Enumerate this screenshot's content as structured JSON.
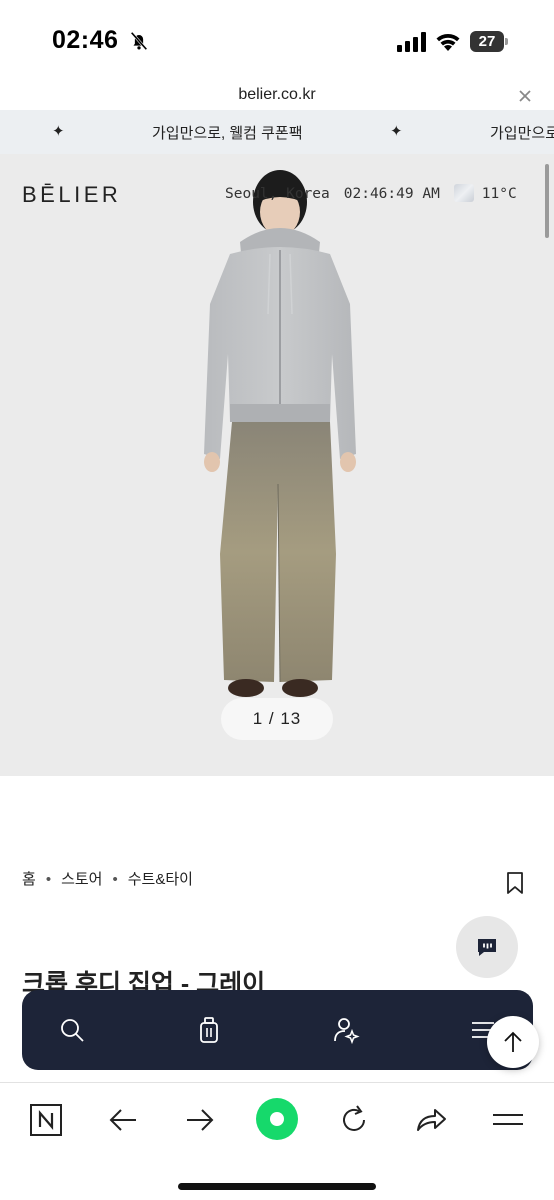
{
  "status_bar": {
    "time": "02:46",
    "battery": "27"
  },
  "url_bar": {
    "domain": "belier.co.kr"
  },
  "banner": {
    "text": "가입만으로, 웰컴 쿠폰팩",
    "star": "✦"
  },
  "hero": {
    "logo": "BĒLIER",
    "city": "Seoul, Korea",
    "clock": "02:46:49 AM",
    "temperature": "11°C",
    "image_counter": "1 / 13"
  },
  "breadcrumb": {
    "items": [
      "홈",
      "스토어",
      "수트&타이"
    ],
    "separator": "•"
  },
  "product": {
    "title": "크롭 후디 집업 - 그레이"
  },
  "site_toolbar": {
    "icons": [
      "search-icon",
      "bag-icon",
      "user-sparkle-icon",
      "menu-icon"
    ]
  },
  "browser_bar": {
    "icons": [
      "naver-icon",
      "back-arrow-icon",
      "forward-arrow-icon",
      "green-home-button",
      "refresh-icon",
      "share-icon",
      "menu-icon"
    ]
  },
  "colors": {
    "toolbar_bg": "#1d2438",
    "hero_bg": "#ebebeb",
    "banner_bg": "#eceff2",
    "accent_green": "#16d96b"
  }
}
